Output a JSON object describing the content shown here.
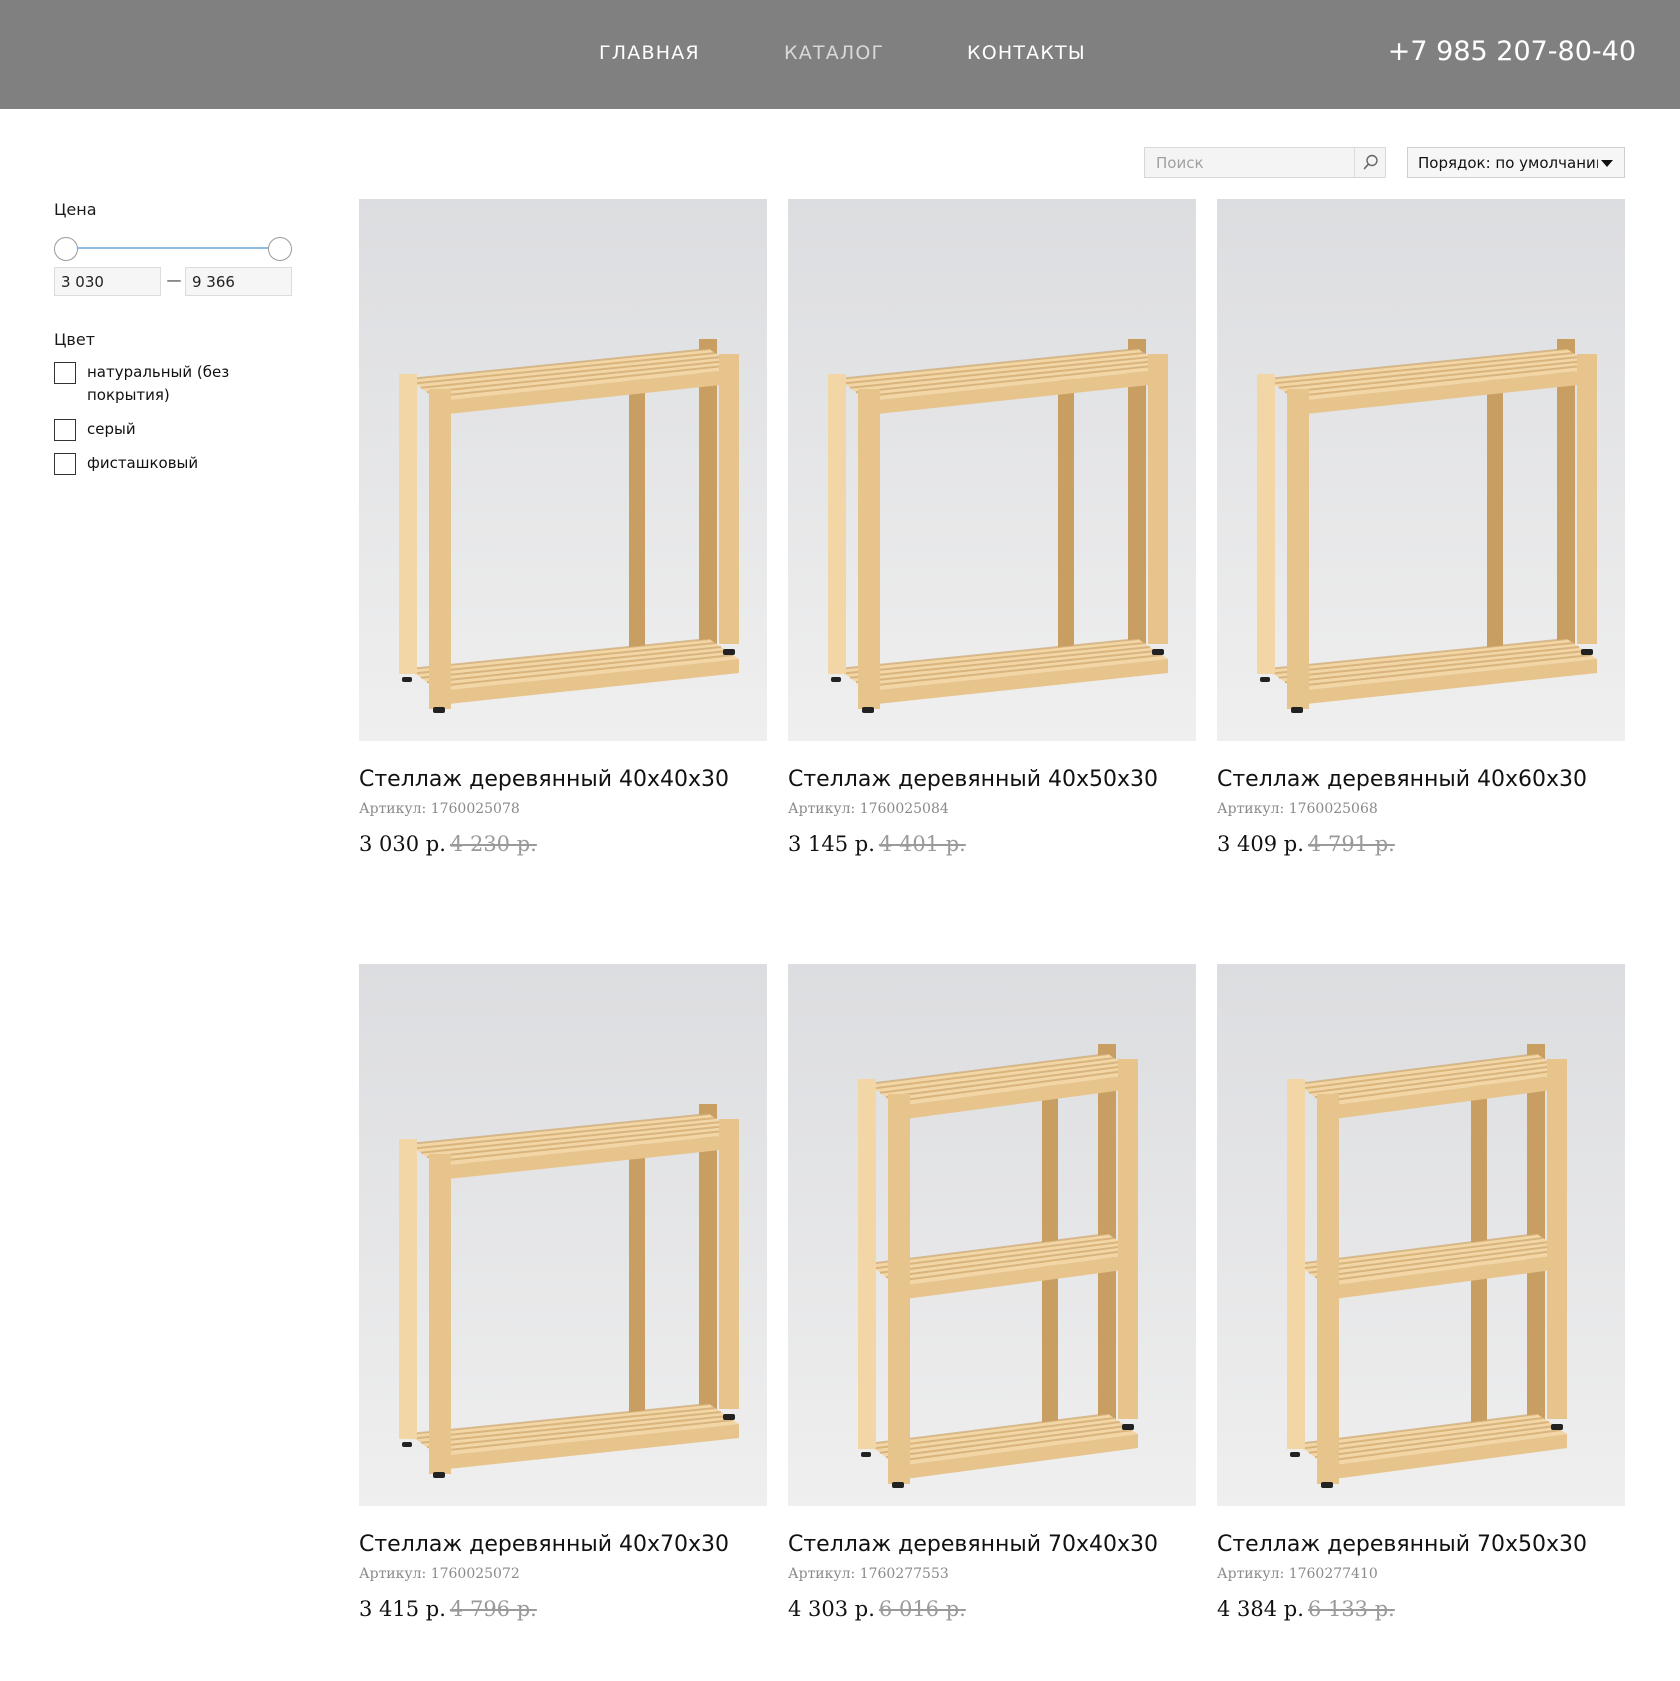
{
  "header": {
    "nav": [
      {
        "label": "ГЛАВНАЯ"
      },
      {
        "label": "КАТАЛОГ"
      },
      {
        "label": "КОНТАКТЫ"
      }
    ],
    "active_nav": "КАТАЛОГ",
    "phone": "+7 985 207-80-40"
  },
  "filters": {
    "price": {
      "title": "Цена",
      "min": "3 030",
      "max": "9 366",
      "dash": "—"
    },
    "color": {
      "title": "Цвет",
      "options": [
        {
          "label": "натуральный (без покрытия)",
          "checked": false
        },
        {
          "label": "серый",
          "checked": false
        },
        {
          "label": "фисташковый",
          "checked": false
        }
      ]
    }
  },
  "toolbar": {
    "search_placeholder": "Поиск",
    "sort_label": "Порядок: по умолчанию"
  },
  "products": [
    {
      "title": "Стеллаж деревянный 40х40х30",
      "sku_label": "Артикул:",
      "sku": "1760025078",
      "price": "3 030 р.",
      "old_price": "4 230 р.",
      "shelves": 2
    },
    {
      "title": "Стеллаж деревянный 40х50х30",
      "sku_label": "Артикул:",
      "sku": "1760025084",
      "price": "3 145 р.",
      "old_price": "4 401 р.",
      "shelves": 2
    },
    {
      "title": "Стеллаж деревянный 40х60х30",
      "sku_label": "Артикул:",
      "sku": "1760025068",
      "price": "3 409 р.",
      "old_price": "4 791 р.",
      "shelves": 2
    },
    {
      "title": "Стеллаж деревянный 40х70х30",
      "sku_label": "Артикул:",
      "sku": "1760025072",
      "price": "3 415 р.",
      "old_price": "4 796 р.",
      "shelves": 2
    },
    {
      "title": "Стеллаж деревянный 70х40х30",
      "sku_label": "Артикул:",
      "sku": "1760277553",
      "price": "4 303 р.",
      "old_price": "6 016 р.",
      "shelves": 3
    },
    {
      "title": "Стеллаж деревянный 70х50х30",
      "sku_label": "Артикул:",
      "sku": "1760277410",
      "price": "4 384 р.",
      "old_price": "6 133 р.",
      "shelves": 3
    }
  ],
  "colors": {
    "header_bg": "#808080",
    "nav_text": "#ffffff",
    "nav_active": "#d9d9d9",
    "wood": "#e8c48d",
    "photo_bg": "#e3e3e5",
    "old_price": "#9a9a9a",
    "slider": "#8bbde6"
  }
}
